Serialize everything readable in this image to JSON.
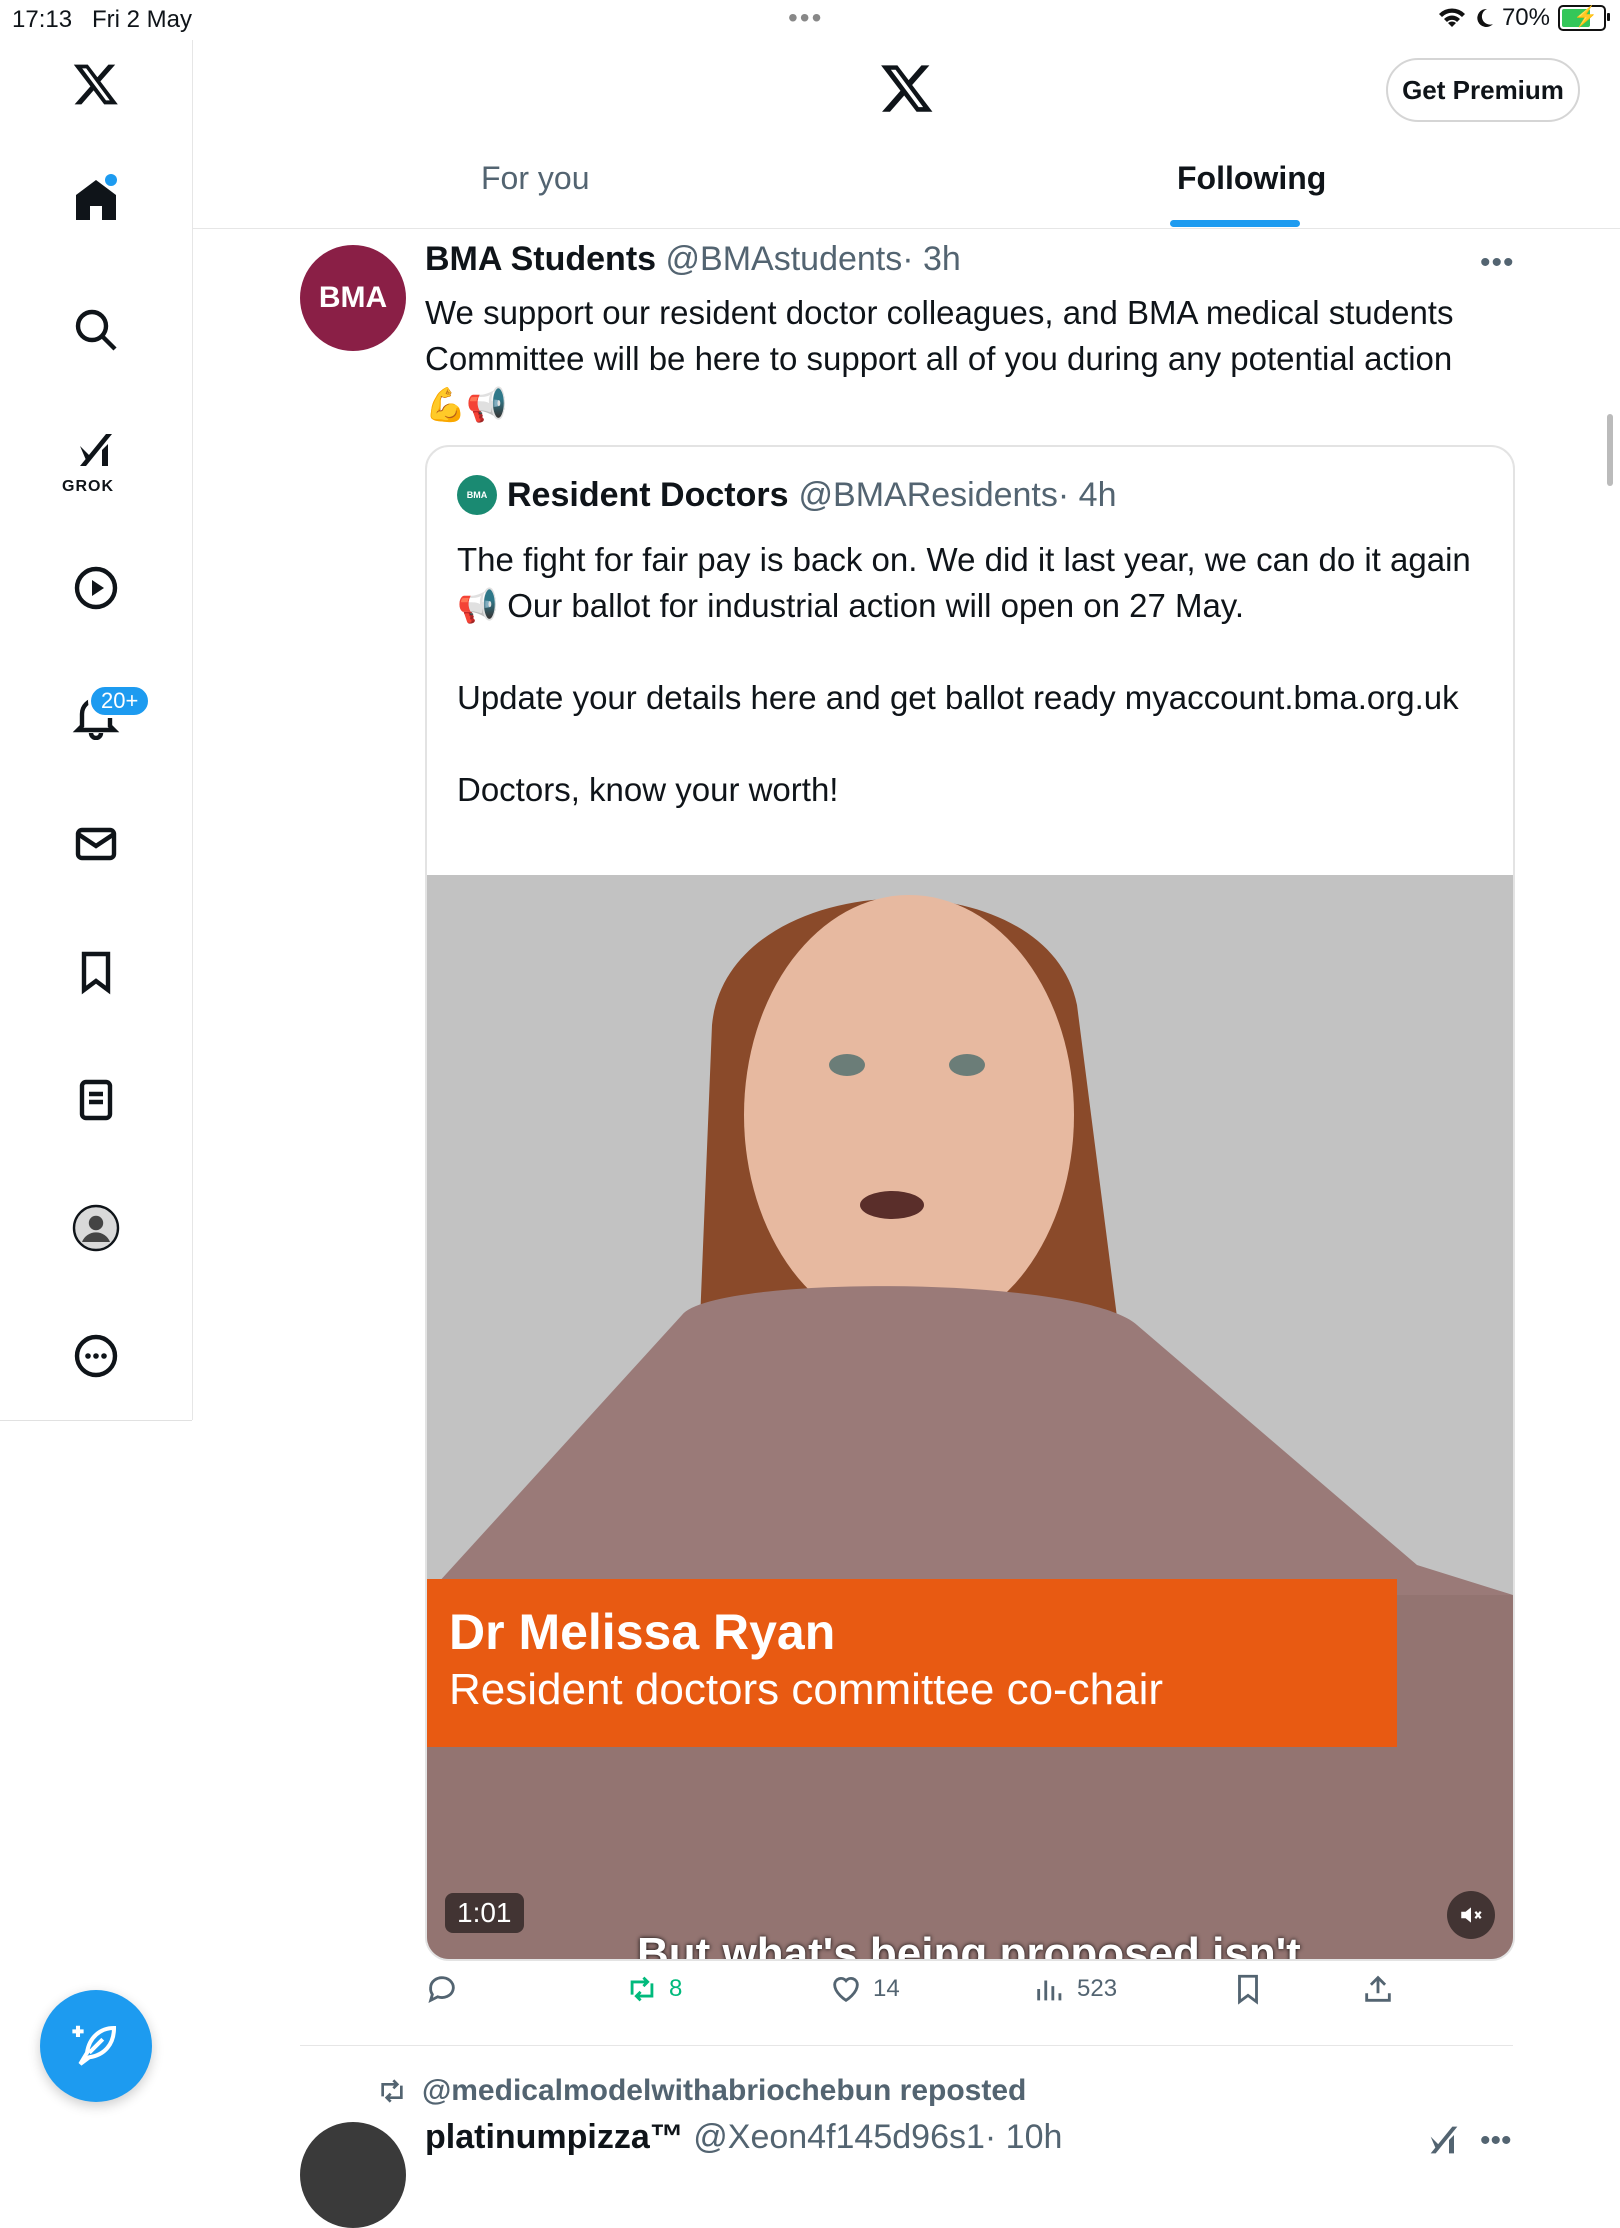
{
  "status_bar": {
    "time": "17:13",
    "date": "Fri 2 May",
    "battery": "70%",
    "battery_level": 0.7
  },
  "sidebar": {
    "items": [
      {
        "icon": "x-logo-icon"
      },
      {
        "icon": "home-icon"
      },
      {
        "icon": "search-icon"
      },
      {
        "icon": "grok-icon",
        "label": "GROK"
      },
      {
        "icon": "video-play-icon"
      },
      {
        "icon": "bell-icon",
        "badge": "20+"
      },
      {
        "icon": "mail-icon"
      },
      {
        "icon": "bookmark-icon"
      },
      {
        "icon": "list-icon"
      },
      {
        "icon": "profile-icon"
      },
      {
        "icon": "more-circle-icon"
      }
    ]
  },
  "header": {
    "premium_label": "Get Premium",
    "tabs": [
      {
        "label": "For you"
      },
      {
        "label": "Following",
        "active": true
      }
    ]
  },
  "post": {
    "avatar_text": "BMA",
    "name": "BMA Students",
    "handle": "@BMAstudents",
    "time": "· 3h",
    "text": "We support our resident doctor colleagues, and BMA medical students Committee will be here to support all of you during any potential action",
    "emojis": "💪📢",
    "quote": {
      "avatar_text": "BMA",
      "name": "Resident Doctors",
      "handle": "@BMAResidents",
      "time": "· 4h",
      "paragraphs": [
        "The fight for fair pay is back on. We did it last year, we can do it again 📢 Our ballot for industrial action will open on 27 May.",
        "Update your details here and get ballot ready myaccount.bma.org.uk",
        "Doctors, know your worth!"
      ],
      "video": {
        "lower_third_name": "Dr Melissa Ryan",
        "lower_third_role": "Resident doctors committee co-chair",
        "duration": "1:01",
        "caption": "But what's being proposed isn't"
      }
    },
    "actions": {
      "reposts": "8",
      "likes": "14",
      "views": "523"
    }
  },
  "next_post": {
    "reposted_by": "@medicalmodelwithabriochebun reposted",
    "name": "platinumpizza™",
    "handle": "@Xeon4f145d96s1",
    "time": "· 10h"
  },
  "colors": {
    "accent": "#1d9bf0",
    "repost_green": "#00ba7c",
    "bma_maroon": "#8a1f46",
    "lower_third": "#e85a12"
  }
}
